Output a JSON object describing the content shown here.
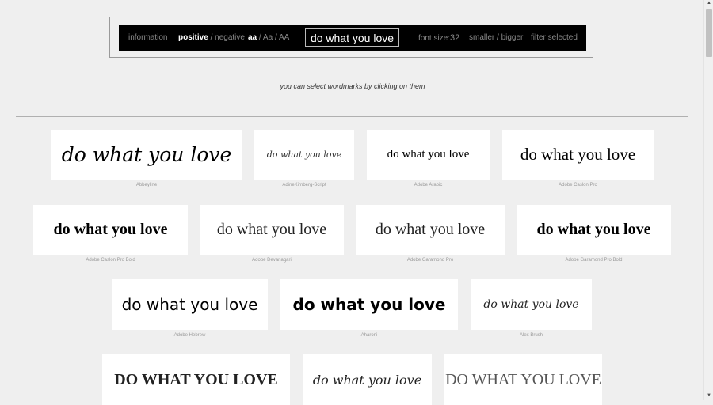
{
  "toolbar": {
    "information": "information",
    "positive": "positive",
    "slash": "/",
    "negative": "negative",
    "case_lower": "aa",
    "case_title": "Aa",
    "case_upper": "AA",
    "preview_text": "do what you love",
    "font_size_label": "font size:",
    "font_size_value": "32",
    "smaller": "smaller",
    "bigger": "bigger",
    "filter_selected": "filter selected"
  },
  "hint": "you can select wordmarks by clicking on them",
  "fonts": [
    {
      "name": "Abbeyline",
      "sample": "do what you love"
    },
    {
      "name": "AdineKirnberg-Script",
      "sample": "do what you love"
    },
    {
      "name": "Adobe Arabic",
      "sample": "do what you love"
    },
    {
      "name": "Adobe Caslon Pro",
      "sample": "do what you love"
    },
    {
      "name": "Adobe Caslon Pro Bold",
      "sample": "do what you love"
    },
    {
      "name": "Adobe Devanagari",
      "sample": "do what you love"
    },
    {
      "name": "Adobe Garamond Pro",
      "sample": "do what you love"
    },
    {
      "name": "Adobe Garamond Pro Bold",
      "sample": "do what you love"
    },
    {
      "name": "Adobe Hebrew",
      "sample": "do what you love"
    },
    {
      "name": "Aharoni",
      "sample": "do what you love"
    },
    {
      "name": "Alex Brush",
      "sample": "do what you love"
    },
    {
      "name": "",
      "sample": "DO WHAT YOU LOVE"
    },
    {
      "name": "",
      "sample": "do what you love"
    },
    {
      "name": "",
      "sample": "DO WHAT YOU LOVE"
    }
  ]
}
